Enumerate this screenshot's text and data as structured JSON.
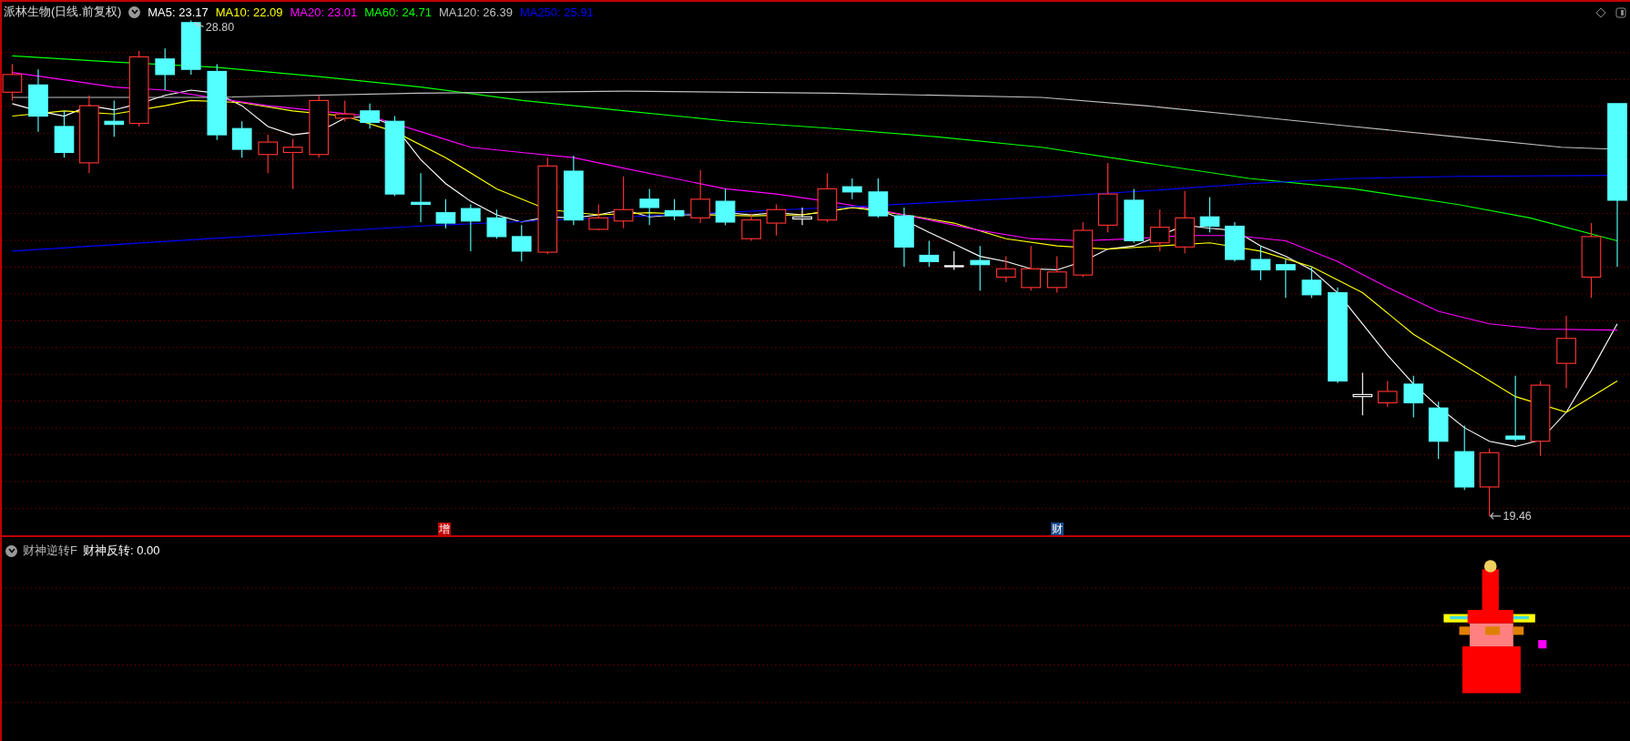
{
  "header": {
    "title": "派林生物(日线.前复权)",
    "averages": [
      {
        "label": "MA5: 23.17",
        "color": "#ffffff"
      },
      {
        "label": "MA10: 22.09",
        "color": "#ffff00"
      },
      {
        "label": "MA20: 23.01",
        "color": "#ff00ff"
      },
      {
        "label": "MA60: 24.71",
        "color": "#00ff00"
      },
      {
        "label": "MA120: 26.39",
        "color": "#c0c0c0"
      },
      {
        "label": "MA250: 25.91",
        "color": "#0000ff"
      }
    ]
  },
  "price_labels": {
    "high": "28.80",
    "low": "19.46"
  },
  "markers": [
    {
      "text": "增",
      "color": "#c00000"
    },
    {
      "text": "财",
      "color": "#1a4a8a"
    }
  ],
  "indicator": {
    "name": "财神逆转F",
    "reading": "财神反转: 0.00"
  }
}
